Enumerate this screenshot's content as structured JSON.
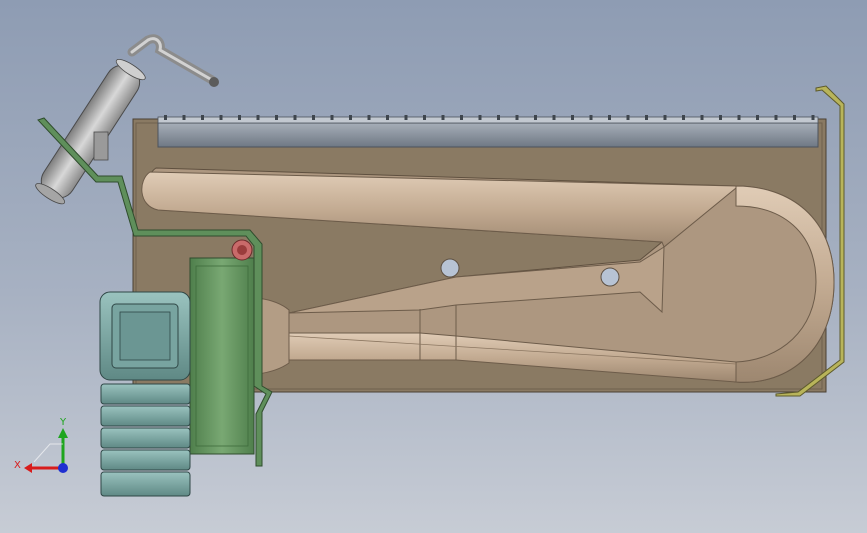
{
  "viewport": {
    "background_top": "#8e9cb3",
    "background_bottom": "#c7ccd5"
  },
  "model": {
    "tray_color": "#8a7a63",
    "tube_color": "#c3ab92",
    "bracket_color": "#5f8f5b",
    "manifold_color": "#8e96a0",
    "rod_color": "#b8b8b8",
    "fitting_color": "#c96a6a",
    "flange_color": "#7fa9a6",
    "right_clip_color": "#b8b45a"
  },
  "triad": {
    "x_label": "X",
    "y_label": "Y",
    "x_color": "#d81c1c",
    "y_color": "#1ea51e",
    "z_color": "#1f2fd1"
  }
}
